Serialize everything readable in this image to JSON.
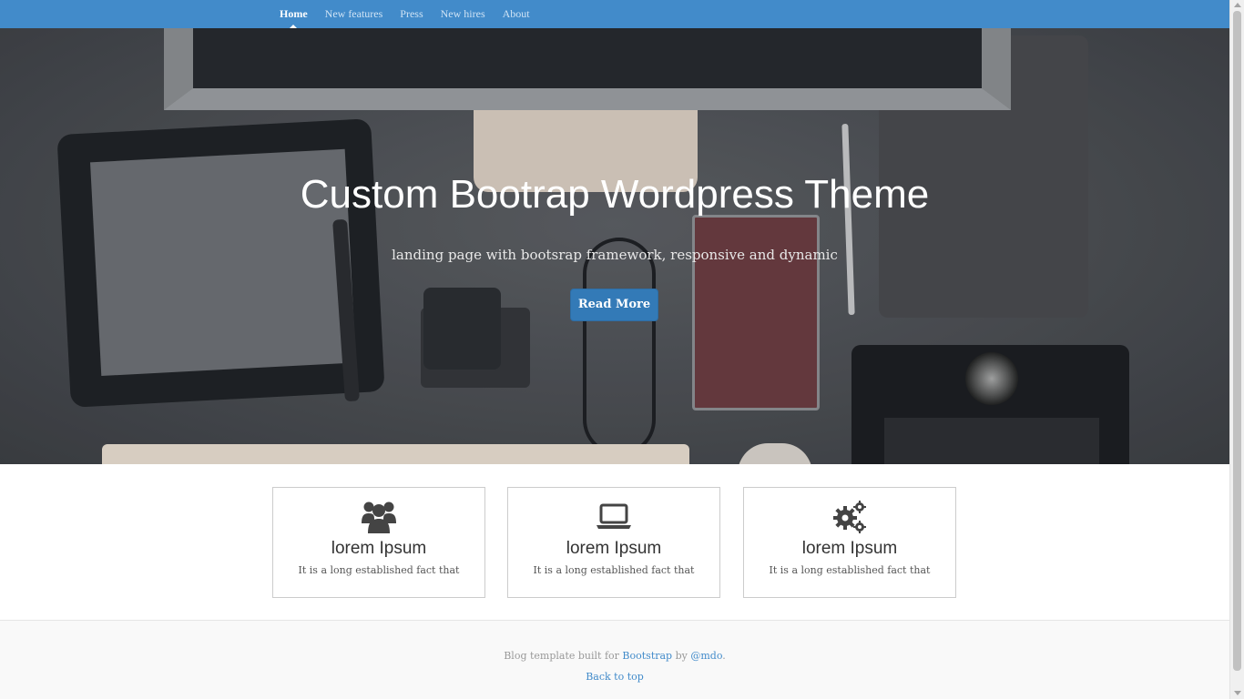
{
  "nav": {
    "items": [
      {
        "label": "Home",
        "active": true
      },
      {
        "label": "New features",
        "active": false
      },
      {
        "label": "Press",
        "active": false
      },
      {
        "label": "New hires",
        "active": false
      },
      {
        "label": "About",
        "active": false
      }
    ]
  },
  "hero": {
    "title": "Custom Bootrap Wordpress Theme",
    "subtitle": "landing page with bootsrap framework, responsive and dynamic",
    "button_label": "Read More"
  },
  "features": [
    {
      "icon": "users-icon",
      "title": "lorem Ipsum",
      "text": "It is a long established fact that"
    },
    {
      "icon": "laptop-icon",
      "title": "lorem Ipsum",
      "text": "It is a long established fact that"
    },
    {
      "icon": "gears-icon",
      "title": "lorem Ipsum",
      "text": "It is a long established fact that"
    }
  ],
  "footer": {
    "text_prefix": "Blog template built for",
    "bootstrap_link": "Bootstrap",
    "text_by": "by",
    "author_link": "@mdo",
    "text_suffix": ".",
    "back_to_top": "Back to top"
  },
  "colors": {
    "navbar": "#428bca",
    "button": "#337ab7",
    "link": "#428bca"
  }
}
